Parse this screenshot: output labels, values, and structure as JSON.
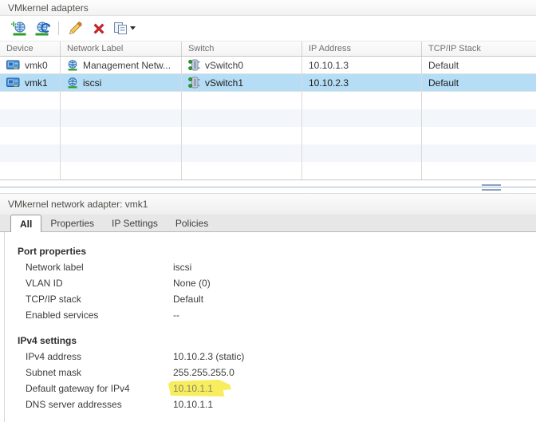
{
  "window": {
    "title": "VMkernel adapters"
  },
  "toolbar": {
    "buttons": [
      {
        "name": "add-networking"
      },
      {
        "name": "refresh"
      },
      {
        "name": "edit"
      },
      {
        "name": "remove"
      },
      {
        "name": "copy"
      }
    ]
  },
  "table": {
    "columns": [
      "Device",
      "Network Label",
      "Switch",
      "IP Address",
      "TCP/IP Stack"
    ],
    "rows": [
      {
        "device": "vmk0",
        "network_label": "Management Netw...",
        "switch": "vSwitch0",
        "ip_address": "10.10.1.3",
        "tcpip_stack": "Default",
        "selected": false
      },
      {
        "device": "vmk1",
        "network_label": "iscsi",
        "switch": "vSwitch1",
        "ip_address": "10.10.2.3",
        "tcpip_stack": "Default",
        "selected": true
      }
    ],
    "empty_row_count": 5
  },
  "detail": {
    "title": "VMkernel network adapter: vmk1",
    "tabs": [
      {
        "label": "All",
        "active": true
      },
      {
        "label": "Properties",
        "active": false
      },
      {
        "label": "IP Settings",
        "active": false
      },
      {
        "label": "Policies",
        "active": false
      }
    ],
    "sections": [
      {
        "heading": "Port properties",
        "rows": [
          [
            "Network label",
            "iscsi"
          ],
          [
            "VLAN ID",
            "None (0)"
          ],
          [
            "TCP/IP stack",
            "Default"
          ],
          [
            "Enabled services",
            "--"
          ]
        ]
      },
      {
        "heading": "IPv4 settings",
        "rows": [
          [
            "IPv4 address",
            "10.10.2.3 (static)"
          ],
          [
            "Subnet mask",
            "255.255.255.0"
          ],
          [
            "Default gateway for IPv4",
            "10.10.1.1"
          ],
          [
            "DNS server addresses",
            "10.10.1.1"
          ]
        ],
        "highlighted_row": 2
      }
    ]
  },
  "colors": {
    "selected_row": "#b5ddf5",
    "alt_row": "#f3f6fa",
    "annotation_highlight": "#f6ec4f",
    "splitter": "#a3b8cf",
    "delete_red": "#c3262c",
    "add_green": "#2e9e27"
  }
}
